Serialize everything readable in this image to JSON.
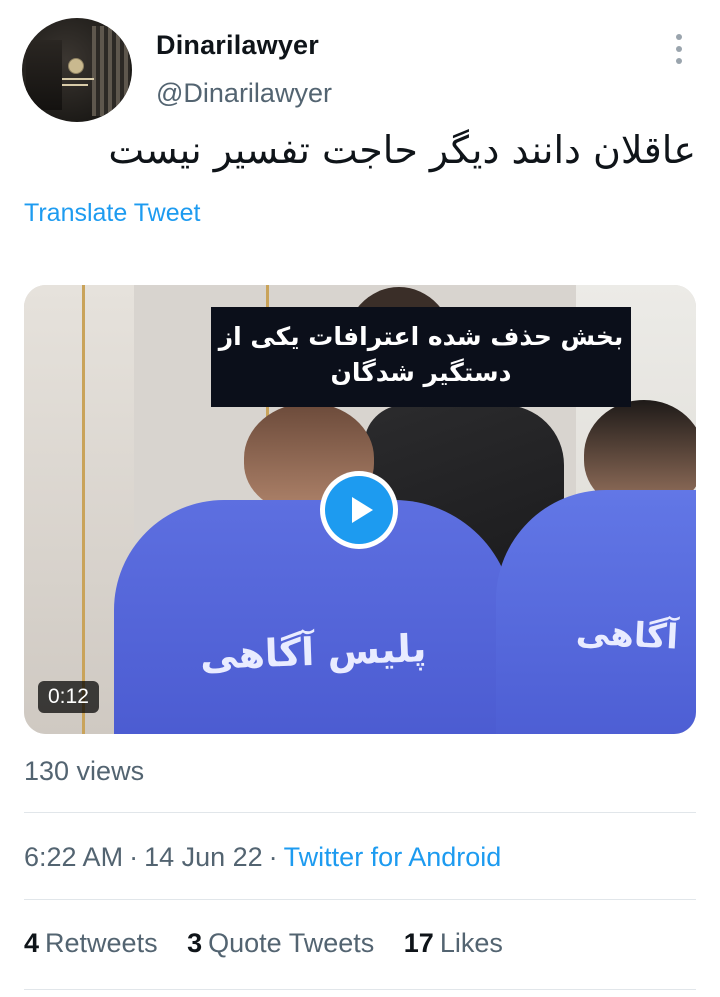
{
  "user": {
    "display_name": "Dinarilawyer",
    "handle": "@Dinarilawyer",
    "avatar_icon": "profile-photo"
  },
  "tweet": {
    "text": "عاقلان دانند دیگر حاجت تفسیر نیست",
    "translate_label": "Translate Tweet"
  },
  "media": {
    "caption_line1": "بخش حذف شده اعترافات یکی از",
    "caption_line2": "دستگیر شدگان",
    "shirt_text_left": "پلیس آگاهی",
    "shirt_text_right": "آگاهی",
    "duration": "0:12",
    "play_icon": "play-icon",
    "accent_color": "#1d9bf0"
  },
  "views": "130 views",
  "meta": {
    "time": "6:22 AM",
    "separator": "·",
    "date": "14 Jun 22",
    "source": "Twitter for Android"
  },
  "stats": {
    "retweets_count": "4",
    "retweets_label": "Retweets",
    "quotes_count": "3",
    "quotes_label": "Quote Tweets",
    "likes_count": "17",
    "likes_label": "Likes"
  }
}
